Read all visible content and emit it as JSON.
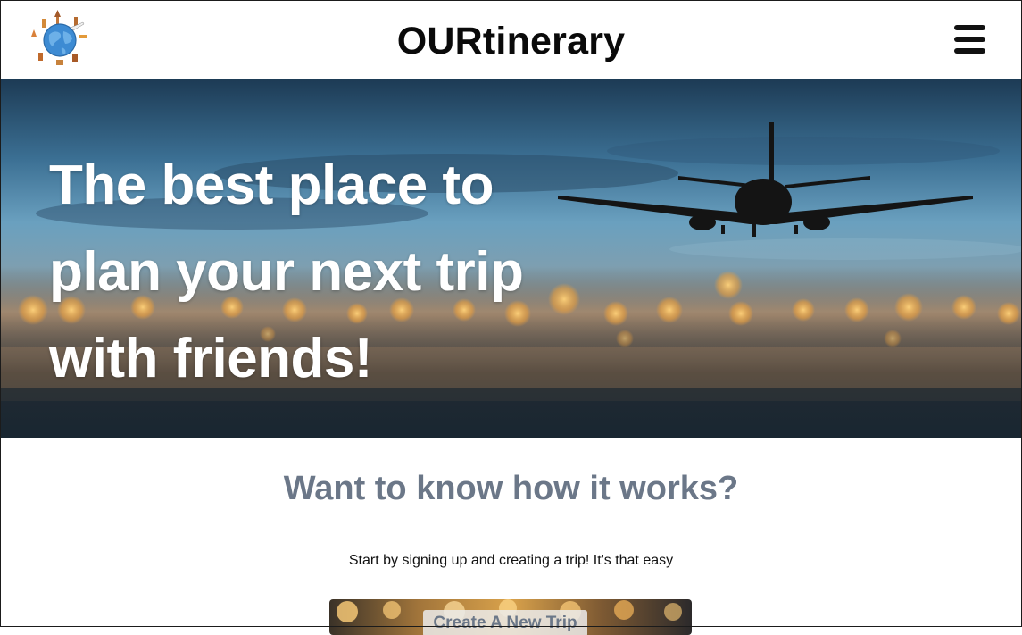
{
  "header": {
    "brand": "OURtinerary",
    "logo_icon": "globe-landmarks-logo",
    "menu_icon": "hamburger-menu-icon"
  },
  "hero": {
    "headline_lines": [
      "The best place to",
      "plan your next trip",
      "with friends!"
    ],
    "image": "airplane-over-blurred-city-lights"
  },
  "how_it_works": {
    "title": "Want to know how it works?",
    "description": "Start by signing up and creating a trip! It's that easy",
    "cta_label": "Create A New Trip"
  },
  "colors": {
    "brand_text": "#0a0a0a",
    "section_title": "#6b7788",
    "hero_text": "#ffffff"
  }
}
